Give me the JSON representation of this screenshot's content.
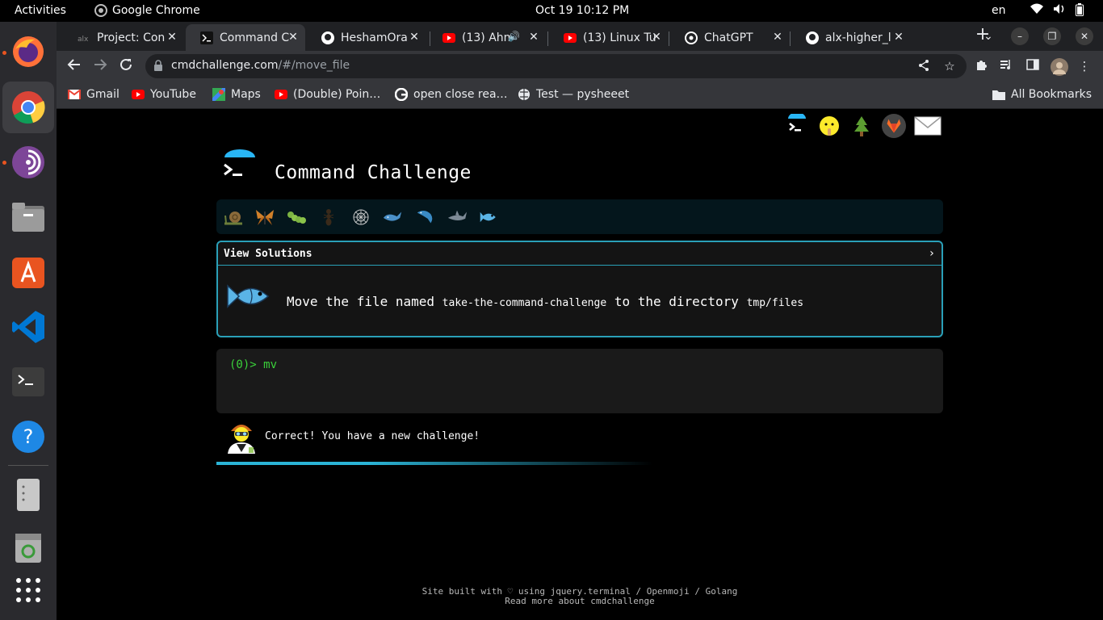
{
  "system": {
    "activities": "Activities",
    "app_name": "Google Chrome",
    "clock": "Oct 19  10:12 PM",
    "lang": "en"
  },
  "tabs": [
    {
      "label": "Project: Con",
      "icon": "alx-icon"
    },
    {
      "label": "Command C",
      "icon": "terminal-icon",
      "active": true
    },
    {
      "label": "HeshamOra",
      "icon": "github-icon"
    },
    {
      "label": "(13) Ahm",
      "icon": "youtube-icon"
    },
    {
      "label": "(13) Linux Tu",
      "icon": "youtube-icon"
    },
    {
      "label": "ChatGPT",
      "icon": "chatgpt-icon"
    },
    {
      "label": "alx-higher_l",
      "icon": "github-icon"
    }
  ],
  "address": {
    "domain": "cmdchallenge.com",
    "path": "/#/move_file"
  },
  "bookmarks": [
    {
      "label": "Gmail",
      "icon": "gmail-icon"
    },
    {
      "label": "YouTube",
      "icon": "youtube-icon"
    },
    {
      "label": "Maps",
      "icon": "maps-icon"
    },
    {
      "label": "(Double) Poin…",
      "icon": "youtube-icon"
    },
    {
      "label": "open close rea…",
      "icon": "google-icon"
    },
    {
      "label": "Test — pysheeet",
      "icon": "globe-icon"
    }
  ],
  "all_bookmarks": "All Bookmarks",
  "page": {
    "title": "Command Challenge",
    "view_solutions": "View Solutions",
    "chevron": "›",
    "task_prefix": "Move the file named",
    "task_file": "take-the-command-challenge",
    "task_middle": "to the directory",
    "task_dir": "tmp/files",
    "prompt": "(0)> ",
    "command": "mv",
    "result_message": "Correct! You have a new challenge!",
    "footer_line1": "Site built with ♡ using jquery.terminal / Openmoji / Golang",
    "footer_line2": "Read more about cmdchallenge"
  },
  "colors": {
    "accent": "#2aa0b8",
    "prompt_green": "#3ad13a",
    "progress_bg": "#04161c"
  }
}
